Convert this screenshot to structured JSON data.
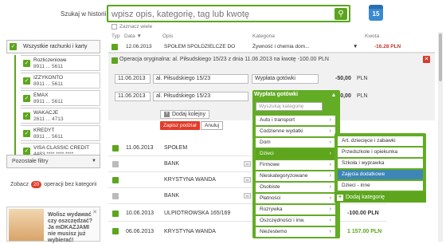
{
  "search": {
    "label": "Szukaj w historii:",
    "placeholder": "wpisz opis, kategorię, tag lub kwotę",
    "multi": "Zaznacz wiele",
    "cal_num": "15"
  },
  "header": {
    "type": "Typ",
    "date": "Data ▼",
    "desc": "Opis",
    "cat": "Kategoria",
    "amount": "Kwota"
  },
  "sidebar": {
    "all": "Wszystkie rachunki i karty",
    "accounts": [
      {
        "name": "Rozliczeniowe",
        "num": "8911 ... 5611"
      },
      {
        "name": "IZZYKONTO",
        "num": "8911 ... 5611"
      },
      {
        "name": "EMAX",
        "num": "8911 ... 5611"
      },
      {
        "name": "WAKACJE",
        "num": "2611 ... 4713"
      },
      {
        "name": "KREDYT",
        "num": "8911 ... 5611"
      },
      {
        "name": "VISA CLASSIC CREDIT",
        "num": "4483 **** **** ****"
      }
    ],
    "filters": "Pozostałe filtry",
    "nocat_pre": "Zobacz",
    "nocat_count": "20",
    "nocat_post": "operacji bez kategorii",
    "ad": "Wolisz wydawać czy oszczędzać? Ja mDKAZJAMI nie musisz już wybierać!"
  },
  "top_row": {
    "date": "12.06.2013",
    "desc": "SPOŁEM SPOLDZIELCZE DO",
    "cat": "Żywność i chemia dom...",
    "amount": "-16.28 PLN"
  },
  "panel": {
    "orig": "Operacja oryginalna: al. Piłsudskiego 15/23 z dnia 11.06.2013 na kwotę -100.00 PLN",
    "r1": {
      "date": "11.06.2013",
      "desc": "al. Piłsudskiego 15/23",
      "cat": "Wypłata gotówki",
      "amount": "-50,00",
      "cur": "PLN"
    },
    "r2": {
      "date": "11.06.2013",
      "desc": "al. Piłsudskiego 15/23",
      "cat": "Wypłata gotówki",
      "amount": "-50,00",
      "cur": "PLN"
    },
    "add": "Dodaj kolejny"
  },
  "buttons": {
    "save": "Zapisz podział",
    "cancel": "Anuluj"
  },
  "rows": [
    {
      "date": "11.06.2013",
      "desc": "SPOŁEM",
      "amount": "",
      "color": "#333"
    },
    {
      "date": "",
      "desc": "BANK",
      "amount": "",
      "color": "#333"
    },
    {
      "date": "",
      "desc": "KRYSTYNA WANDA",
      "amount": "",
      "color": "#333"
    },
    {
      "date": "",
      "desc": "BANK",
      "amount": "",
      "color": "#333"
    },
    {
      "date": "10.06.2013",
      "desc": "ULPIOTROWSKA 165/169",
      "amount": "-100.00 PLN",
      "color": "#333"
    },
    {
      "date": "06.06.2013",
      "desc": "KRYSTYNA WANDA",
      "amount": "1 157.00 PLN",
      "color": "#5ca51d"
    }
  ],
  "dropdown": {
    "head": "Wypłata gotówki",
    "search": "Wyszukaj kategorię",
    "items": [
      "Auto i transport",
      "Codzienne wydatki",
      "Dom",
      "Dzieci",
      "Firmowe",
      "Nieskategoryzowane",
      "Osobiste",
      "Płatności",
      "Rozrywka",
      "Oszczędności i inw.",
      "Niezestemo"
    ],
    "active": 3
  },
  "submenu": {
    "items": [
      "Art. dziecięce i zabawki",
      "Przedszkole i opiekunka",
      "Szkoła i wyprawka",
      "Zajęcia dodatkowe",
      "Dzieci - inne"
    ],
    "highlight": 3,
    "add": "Dodaj kategorię"
  },
  "colors": {
    "green": "#5ca51d",
    "red": "#e23b2a",
    "blue": "#3d86b5"
  }
}
